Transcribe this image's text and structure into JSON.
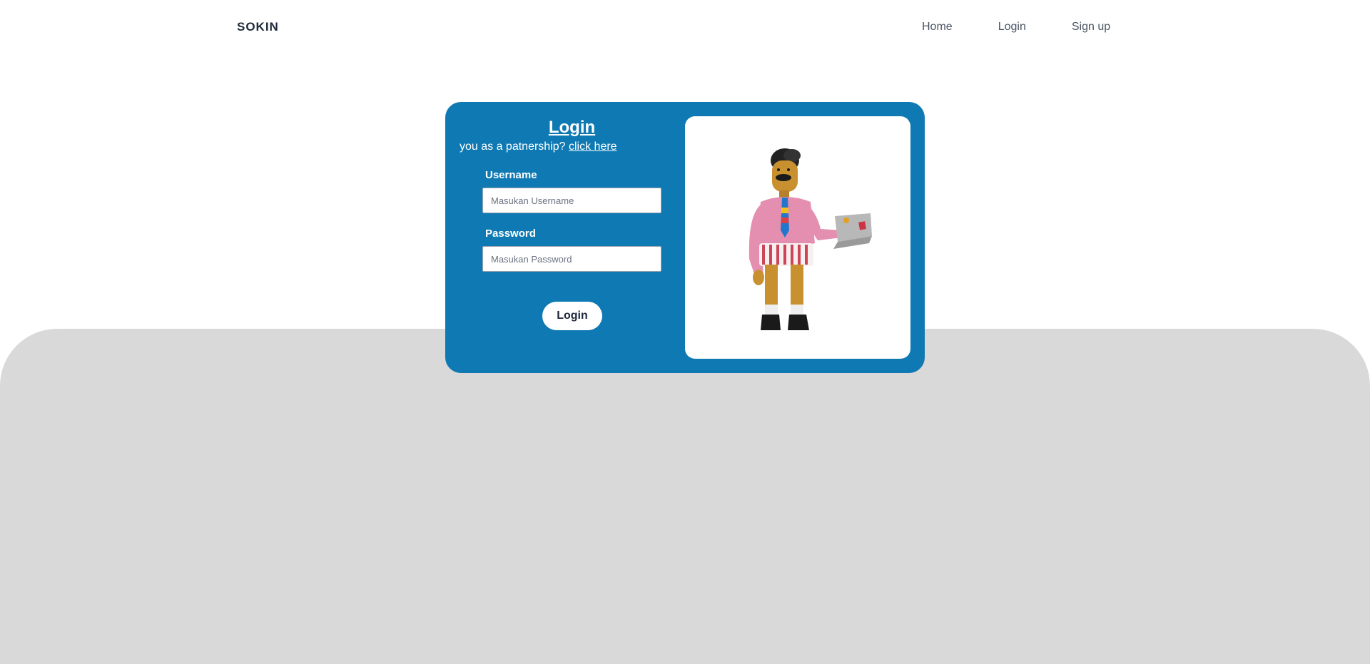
{
  "navbar": {
    "brand": "SOKIN",
    "links": [
      {
        "label": "Home"
      },
      {
        "label": "Login"
      },
      {
        "label": "Sign up"
      }
    ]
  },
  "login_card": {
    "title": "Login",
    "partnership_prompt": "you as a patnership?",
    "partnership_link": "click here",
    "username": {
      "label": "Username",
      "placeholder": "Masukan Username",
      "value": ""
    },
    "password": {
      "label": "Password",
      "placeholder": "Masukan Password",
      "value": ""
    },
    "submit_label": "Login",
    "illustration": "man-holding-laptop-illustration"
  },
  "colors": {
    "card_background": "#0e79b2",
    "page_background": "#ffffff",
    "footer_band": "#d9d9d9",
    "brand_text": "#1e293b"
  }
}
